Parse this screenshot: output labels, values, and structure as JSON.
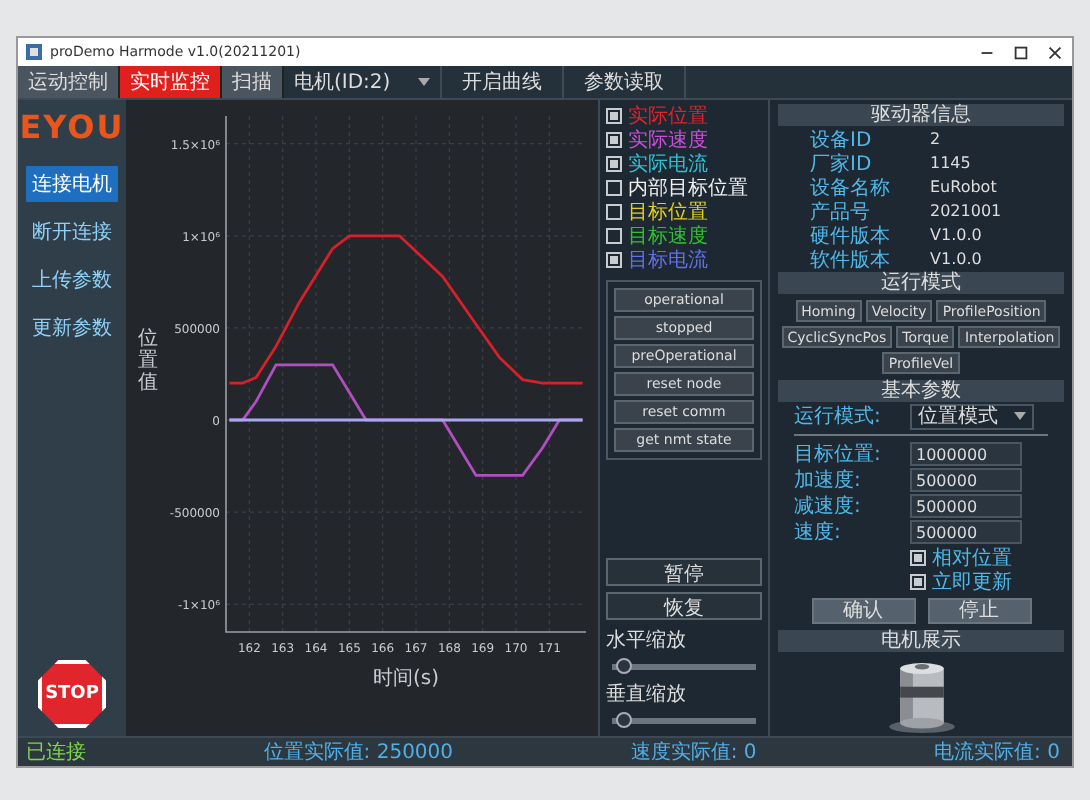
{
  "window": {
    "title": "proDemo Harmode v1.0(20211201)"
  },
  "tabs": [
    {
      "label": "运动控制",
      "selected": false
    },
    {
      "label": "实时监控",
      "selected": true
    },
    {
      "label": "扫描",
      "selected": false
    }
  ],
  "device_select": {
    "value": "电机(ID:2)"
  },
  "toolbar_buttons": [
    "开启曲线",
    "参数读取"
  ],
  "sidebar": {
    "logo": "EYOU",
    "items": [
      {
        "label": "连接电机",
        "selected": true
      },
      {
        "label": "断开连接",
        "selected": false
      },
      {
        "label": "上传参数",
        "selected": false
      },
      {
        "label": "更新参数",
        "selected": false
      }
    ],
    "stop_label": "STOP"
  },
  "chart": {
    "chart_data": {
      "type": "line",
      "xlabel": "时间(s)",
      "ylabel": "位置值",
      "x": [
        161.4,
        161.8,
        162.2,
        162.8,
        163.5,
        164.5,
        165,
        165.5,
        166.5,
        167.8,
        168.8,
        169.5,
        170.2,
        170.8,
        171.3,
        172
      ],
      "grid": true,
      "series": [
        {
          "color": "#d8202a",
          "values": [
            200000,
            200000,
            230000,
            400000,
            640000,
            930000,
            1000000,
            1000000,
            1000000,
            780000,
            520000,
            340000,
            220000,
            200000,
            200000,
            200000
          ]
        },
        {
          "color": "#b04fc0",
          "values": [
            0,
            0,
            100000,
            300000,
            300000,
            300000,
            150000,
            0,
            0,
            0,
            -300000,
            -300000,
            -300000,
            -150000,
            0,
            0
          ]
        },
        {
          "color": "#a8a8f0",
          "values": [
            0,
            0,
            0,
            0,
            0,
            0,
            0,
            0,
            0,
            0,
            0,
            0,
            0,
            0,
            0,
            0
          ]
        }
      ],
      "xlim": [
        161.3,
        172.1
      ],
      "ylim": [
        -1150000,
        1650000
      ],
      "xticks": [
        162,
        163,
        164,
        165,
        166,
        167,
        168,
        169,
        170,
        171
      ],
      "yticks": [
        {
          "value": 1500000,
          "label": "1.5×10⁶"
        },
        {
          "value": 1000000,
          "label": "1×10⁶"
        },
        500000,
        0,
        -500000,
        {
          "value": -1000000,
          "label": "-1×10⁶"
        }
      ]
    }
  },
  "legend": [
    {
      "label": "实际位置",
      "color": "#e0242a",
      "checked": true
    },
    {
      "label": "实际速度",
      "color": "#c84fd8",
      "checked": true
    },
    {
      "label": "实际电流",
      "color": "#30c0d0",
      "checked": true
    },
    {
      "label": "内部目标位置",
      "color": "#f0f0f0",
      "checked": false
    },
    {
      "label": "目标位置",
      "color": "#e0d020",
      "checked": false
    },
    {
      "label": "目标速度",
      "color": "#30c030",
      "checked": false
    },
    {
      "label": "目标电流",
      "color": "#6070e8",
      "checked": true
    }
  ],
  "nmt_buttons": [
    "operational",
    "stopped",
    "preOperational",
    "reset node",
    "reset comm",
    "get nmt state"
  ],
  "pause_buttons": [
    "暂停",
    "恢复"
  ],
  "sliders": [
    {
      "label": "水平缩放",
      "level": 0.03
    },
    {
      "label": "垂直缩放",
      "level": 0.03
    }
  ],
  "drive_info": {
    "title": "驱动器信息",
    "rows": [
      {
        "label": "设备ID",
        "value": "2"
      },
      {
        "label": "厂家ID",
        "value": "1145"
      },
      {
        "label": "设备名称",
        "value": "EuRobot"
      },
      {
        "label": "产品号",
        "value": "2021001"
      },
      {
        "label": "硬件版本",
        "value": "V1.0.0"
      },
      {
        "label": "软件版本",
        "value": "V1.0.0"
      }
    ]
  },
  "run_mode": {
    "title": "运行模式",
    "buttons": [
      "Homing",
      "Velocity",
      "ProfilePosition",
      "CyclicSyncPos",
      "Torque",
      "Interpolation",
      "ProfileVel"
    ]
  },
  "basic_params": {
    "title": "基本参数",
    "mode_label": "运行模式:",
    "mode_value": "位置模式",
    "fields": [
      {
        "label": "目标位置:",
        "value": "1000000"
      },
      {
        "label": "加速度:",
        "value": "500000"
      },
      {
        "label": "减速度:",
        "value": "500000"
      },
      {
        "label": "速度:",
        "value": "500000"
      }
    ],
    "checks": [
      {
        "label": "相对位置",
        "checked": true
      },
      {
        "label": "立即更新",
        "checked": true
      }
    ],
    "buttons": [
      "确认",
      "停止"
    ]
  },
  "motor": {
    "title": "电机展示"
  },
  "status_bar": [
    {
      "text": "已连接",
      "kind": "state"
    },
    {
      "text": "位置实际值: 250000",
      "kind": "reading"
    },
    {
      "text": "速度实际值: 0",
      "kind": "reading"
    },
    {
      "text": "电流实际值: 0",
      "kind": "reading"
    }
  ]
}
